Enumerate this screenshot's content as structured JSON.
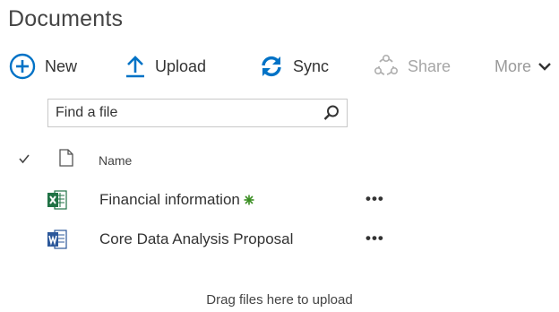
{
  "page": {
    "title": "Documents"
  },
  "toolbar": {
    "new_label": "New",
    "upload_label": "Upload",
    "sync_label": "Sync",
    "share_label": "Share",
    "more_label": "More"
  },
  "search": {
    "placeholder": "Find a file",
    "value": ""
  },
  "list": {
    "column_name": "Name",
    "files": [
      {
        "name": "Financial information",
        "type": "excel",
        "is_new": true,
        "actions": "•••"
      },
      {
        "name": "Core Data Analysis Proposal",
        "type": "word",
        "is_new": false,
        "actions": "•••"
      }
    ]
  },
  "dropzone": {
    "text": "Drag files here to upload"
  },
  "icons": {
    "new": "plus-circle-icon",
    "upload": "upload-arrow-icon",
    "sync": "sync-icon",
    "share": "share-icon",
    "more": "chevron-down-icon",
    "search": "search-icon"
  },
  "colors": {
    "accent": "#0072c6",
    "excel": "#207245",
    "word": "#2b579a",
    "new_marker": "#3a8e22",
    "disabled": "#a6a6a6"
  }
}
